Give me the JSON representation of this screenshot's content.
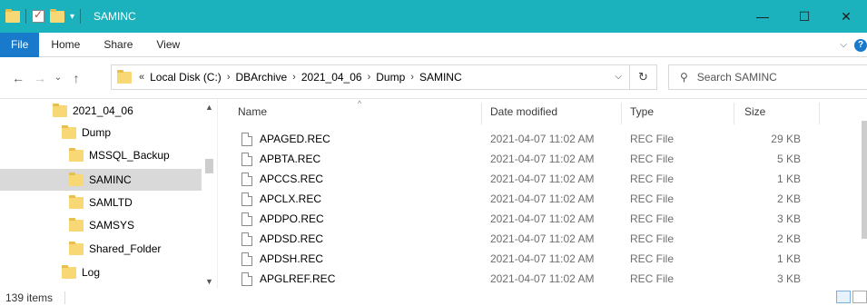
{
  "window": {
    "title": "SAMINC",
    "controls": [
      "minimize",
      "maximize",
      "close"
    ],
    "accent": "#1bb2bd"
  },
  "ribbon": {
    "tabs": [
      "File",
      "Home",
      "Share",
      "View"
    ]
  },
  "address": {
    "prefix": "«",
    "crumbs": [
      "Local Disk (C:)",
      "DBArchive",
      "2021_04_06",
      "Dump",
      "SAMINC"
    ],
    "search_placeholder": "Search SAMINC"
  },
  "nav": {
    "items": [
      {
        "label": "2021_04_06",
        "level": 0
      },
      {
        "label": "Dump",
        "level": 1
      },
      {
        "label": "MSSQL_Backup",
        "level": 2
      },
      {
        "label": "SAMINC",
        "level": 2,
        "selected": true
      },
      {
        "label": "SAMLTD",
        "level": 2
      },
      {
        "label": "SAMSYS",
        "level": 2
      },
      {
        "label": "Shared_Folder",
        "level": 2
      },
      {
        "label": "Log",
        "level": 1
      }
    ]
  },
  "list": {
    "columns": [
      "Name",
      "Date modified",
      "Type",
      "Size"
    ],
    "rows": [
      {
        "name": "APAGED.REC",
        "date": "2021-04-07 11:02 AM",
        "type": "REC File",
        "size": "29 KB"
      },
      {
        "name": "APBTA.REC",
        "date": "2021-04-07 11:02 AM",
        "type": "REC File",
        "size": "5 KB"
      },
      {
        "name": "APCCS.REC",
        "date": "2021-04-07 11:02 AM",
        "type": "REC File",
        "size": "1 KB"
      },
      {
        "name": "APCLX.REC",
        "date": "2021-04-07 11:02 AM",
        "type": "REC File",
        "size": "2 KB"
      },
      {
        "name": "APDPO.REC",
        "date": "2021-04-07 11:02 AM",
        "type": "REC File",
        "size": "3 KB"
      },
      {
        "name": "APDSD.REC",
        "date": "2021-04-07 11:02 AM",
        "type": "REC File",
        "size": "2 KB"
      },
      {
        "name": "APDSH.REC",
        "date": "2021-04-07 11:02 AM",
        "type": "REC File",
        "size": "1 KB"
      },
      {
        "name": "APGLREF.REC",
        "date": "2021-04-07 11:02 AM",
        "type": "REC File",
        "size": "3 KB"
      }
    ]
  },
  "status": {
    "item_count": "139 items"
  }
}
